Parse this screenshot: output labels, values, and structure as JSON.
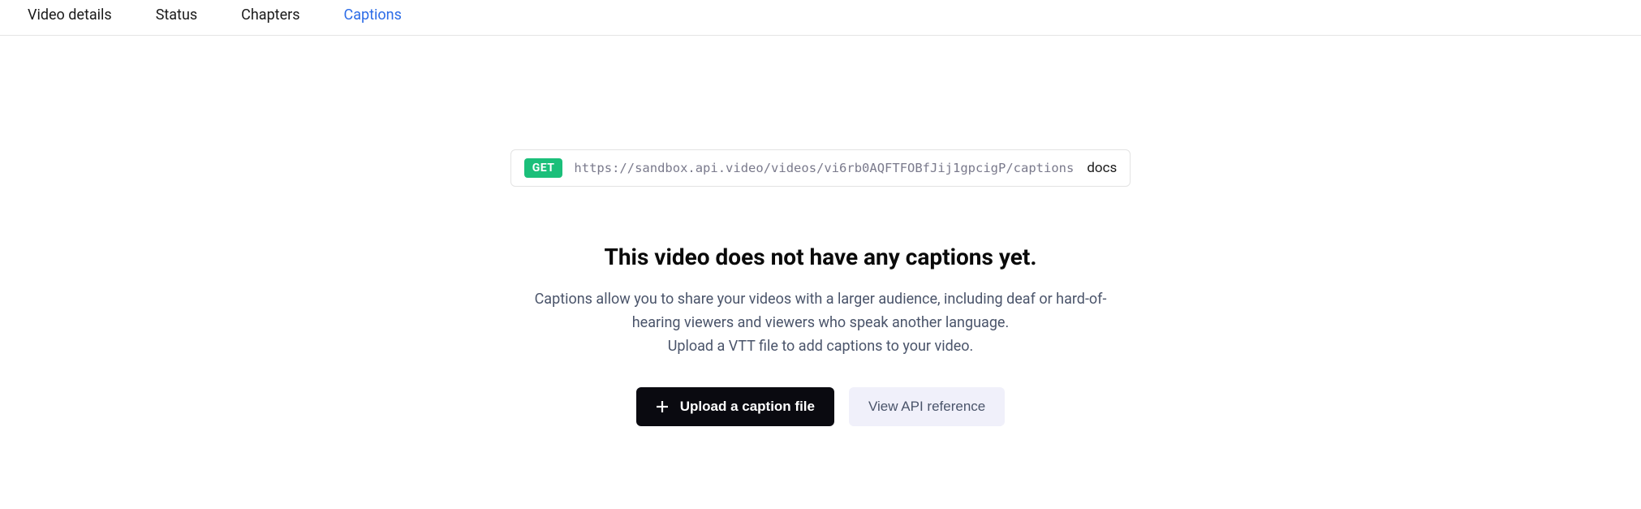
{
  "tabs": [
    {
      "label": "Video details"
    },
    {
      "label": "Status"
    },
    {
      "label": "Chapters"
    },
    {
      "label": "Captions"
    }
  ],
  "api": {
    "method": "GET",
    "url": "https://sandbox.api.video/videos/vi6rb0AQFTFOBfJij1gpcigP/captions",
    "docs_label": "docs"
  },
  "empty_state": {
    "heading": "This video does not have any captions yet.",
    "desc_line1": "Captions allow you to share your videos with a larger audience, including deaf or hard-of-hearing viewers and viewers who speak another language.",
    "desc_line2": "Upload a VTT file to add captions to your video.",
    "upload_button": "Upload a caption file",
    "api_reference_button": "View API reference"
  }
}
